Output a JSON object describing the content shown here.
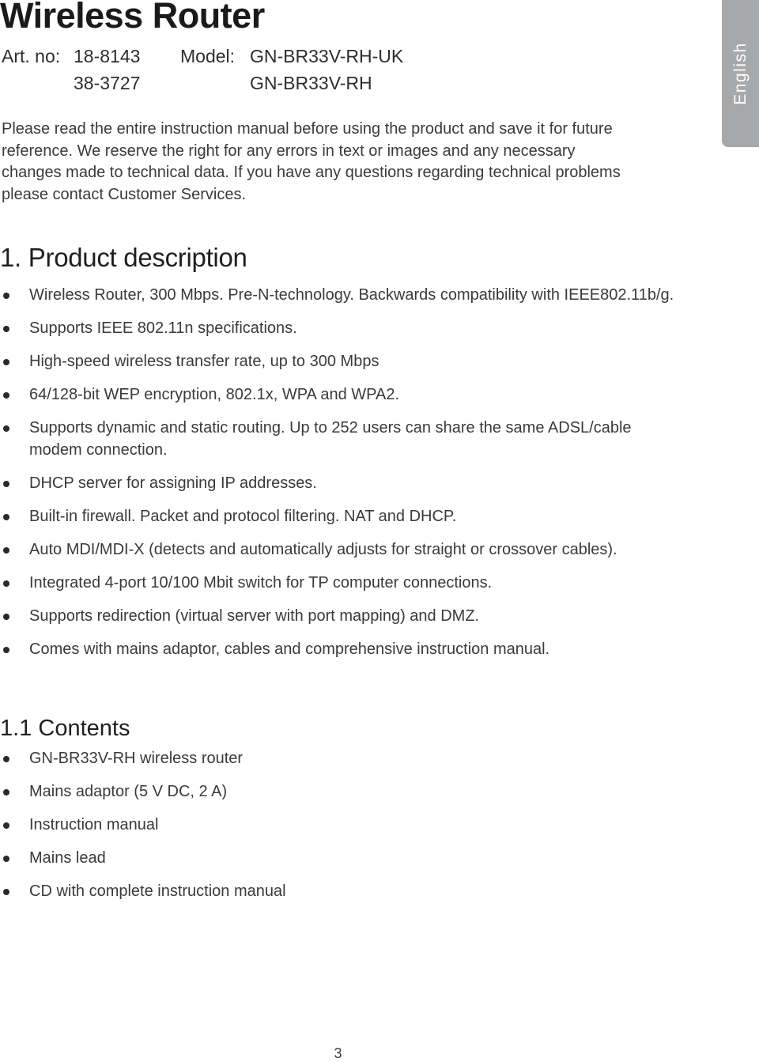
{
  "header": {
    "title": "Wireless Router",
    "art_label": "Art. no:",
    "art_numbers": [
      "18-8143",
      "38-3727"
    ],
    "model_label": "Model:",
    "models": [
      "GN-BR33V-RH-UK",
      "GN-BR33V-RH"
    ]
  },
  "language_tab": {
    "label": "English",
    "color": "#a7a8aa"
  },
  "intro": "Please read the entire instruction manual before using the product and save it for future reference. We reserve the right for any errors in text or images and any necessary changes made to technical data. If you have any questions regarding technical problems please contact Customer Services.",
  "sections": [
    {
      "heading": "1. Product description",
      "items": [
        "Wireless Router, 300 Mbps. Pre-N-technology. Backwards compatibility with IEEE802.11b/g.",
        "Supports IEEE 802.11n specifications.",
        "High-speed wireless transfer rate, up to 300 Mbps",
        "64/128-bit WEP encryption, 802.1x, WPA and WPA2.",
        "Supports dynamic and static routing. Up to 252 users can share the same ADSL/cable modem connection.",
        "DHCP server for assigning IP addresses.",
        "Built-in firewall. Packet and protocol filtering. NAT and DHCP.",
        "Auto MDI/MDI-X (detects and automatically adjusts for straight or crossover cables).",
        "Integrated 4-port 10/100 Mbit switch for TP computer connections.",
        "Supports redirection (virtual server with port mapping) and DMZ.",
        "Comes with mains adaptor, cables and comprehensive instruction manual."
      ]
    },
    {
      "heading": "1.1 Contents",
      "items": [
        "GN-BR33V-RH wireless router",
        "Mains adaptor (5 V DC, 2 A)",
        "Instruction manual",
        "Mains lead",
        "CD with complete instruction manual"
      ]
    }
  ],
  "footer": {
    "page_number": "3"
  }
}
